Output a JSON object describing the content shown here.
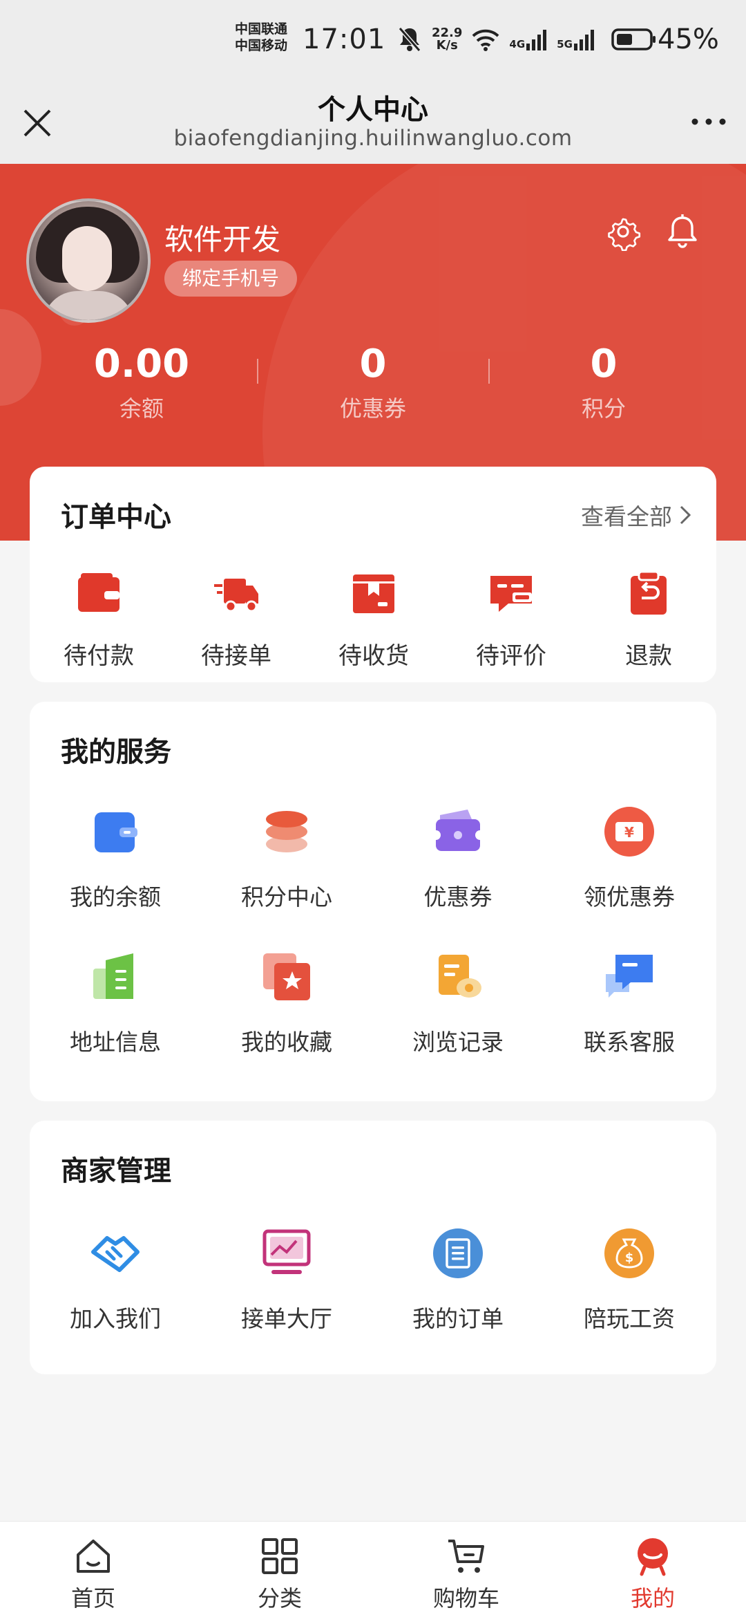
{
  "status_bar": {
    "carrier_1": "中国联通",
    "carrier_2": "中国移动",
    "time": "17:01",
    "speed_value": "22.9",
    "speed_unit": "K/s",
    "net_1": "4G",
    "net_2": "5G",
    "battery": "45%"
  },
  "titlebar": {
    "title": "个人中心",
    "url": "biaofengdianjing.huilinwangluo.com"
  },
  "profile": {
    "username": "软件开发",
    "bind_phone_label": "绑定手机号"
  },
  "stats": [
    {
      "value": "0.00",
      "label": "余额"
    },
    {
      "value": "0",
      "label": "优惠券"
    },
    {
      "value": "0",
      "label": "积分"
    }
  ],
  "orders": {
    "title": "订单中心",
    "view_all": "查看全部",
    "items": [
      {
        "label": "待付款",
        "icon": "wallet-icon"
      },
      {
        "label": "待接单",
        "icon": "truck-icon"
      },
      {
        "label": "待收货",
        "icon": "package-icon"
      },
      {
        "label": "待评价",
        "icon": "comment-icon"
      },
      {
        "label": "退款",
        "icon": "refund-icon"
      }
    ]
  },
  "services": {
    "title": "我的服务",
    "items": [
      {
        "label": "我的余额",
        "icon": "wallet-blue-icon"
      },
      {
        "label": "积分中心",
        "icon": "coins-icon"
      },
      {
        "label": "优惠券",
        "icon": "coupon-wallet-icon"
      },
      {
        "label": "领优惠券",
        "icon": "yen-ticket-icon"
      },
      {
        "label": "地址信息",
        "icon": "address-book-icon"
      },
      {
        "label": "我的收藏",
        "icon": "star-card-icon"
      },
      {
        "label": "浏览记录",
        "icon": "history-doc-icon"
      },
      {
        "label": "联系客服",
        "icon": "chat-support-icon"
      }
    ]
  },
  "merchant": {
    "title": "商家管理",
    "items": [
      {
        "label": "加入我们",
        "icon": "handshake-icon"
      },
      {
        "label": "接单大厅",
        "icon": "monitor-chart-icon"
      },
      {
        "label": "我的订单",
        "icon": "order-list-icon"
      },
      {
        "label": "陪玩工资",
        "icon": "money-bag-icon"
      }
    ]
  },
  "bottom_nav": [
    {
      "label": "首页",
      "icon": "home-icon"
    },
    {
      "label": "分类",
      "icon": "grid-icon"
    },
    {
      "label": "购物车",
      "icon": "cart-icon"
    },
    {
      "label": "我的",
      "icon": "profile-icon",
      "active": true
    }
  ],
  "colors": {
    "accent": "#dd4535",
    "active_tab": "#e23a2f",
    "background": "#f5f5f5"
  }
}
